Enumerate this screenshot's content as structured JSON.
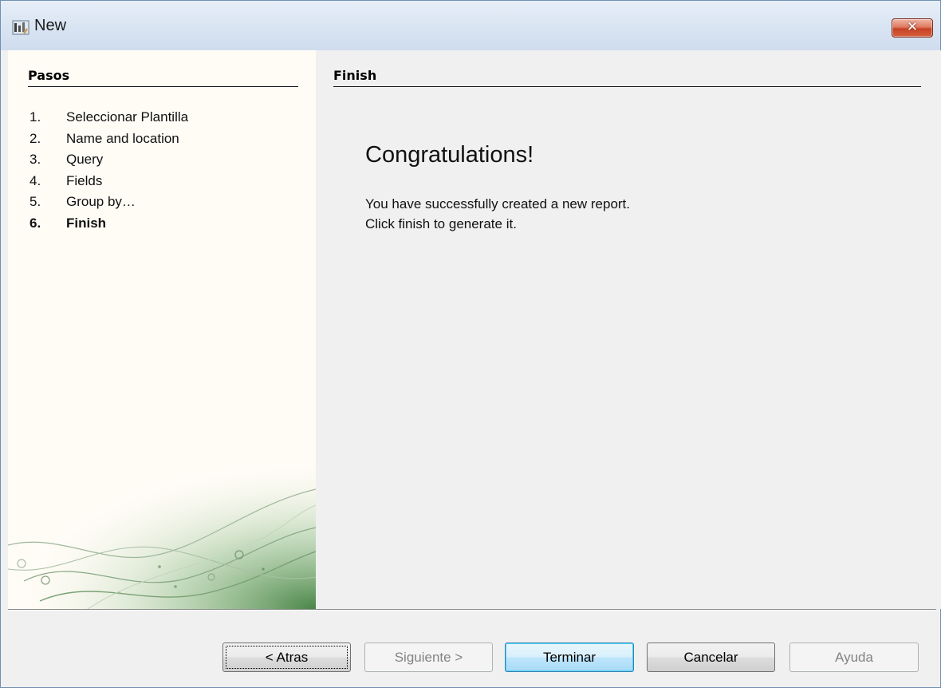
{
  "window": {
    "title": "New",
    "close_symbol": "✕",
    "icon": "wizard-app-icon"
  },
  "steps_panel": {
    "heading": "Pasos",
    "steps": [
      {
        "num": "1.",
        "label": "Seleccionar Plantilla"
      },
      {
        "num": "2.",
        "label": "Name and location"
      },
      {
        "num": "3.",
        "label": "Query"
      },
      {
        "num": "4.",
        "label": "Fields"
      },
      {
        "num": "5.",
        "label": "Group by…"
      },
      {
        "num": "6.",
        "label": "Finish"
      }
    ],
    "current_step": 6
  },
  "content": {
    "heading": "Finish",
    "congrats": "Congratulations!",
    "message_line1": "You have successfully created a new report.",
    "message_line2": "Click finish to generate it."
  },
  "buttons": {
    "back": "< Atras",
    "next": "Siguiente >",
    "finish": "Terminar",
    "cancel": "Cancelar",
    "help": "Ayuda"
  },
  "colors": {
    "steps_panel_bg": "#fffcf6",
    "decor_green": "#5d9a5a",
    "close_red": "#c74224"
  }
}
